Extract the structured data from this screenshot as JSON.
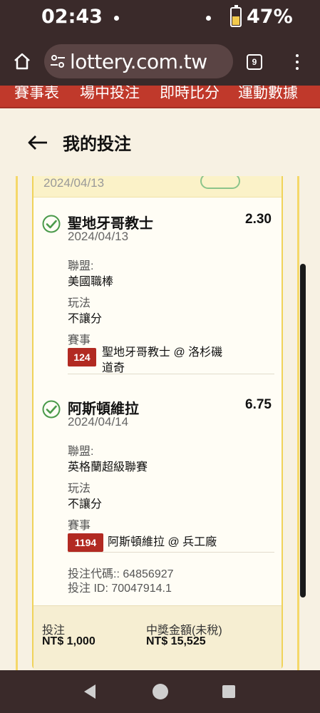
{
  "status_bar": {
    "time": "02:43",
    "battery": "47%"
  },
  "browser": {
    "url": "lottery.com.tw",
    "tab_count": "9"
  },
  "site_nav": {
    "items": [
      "賽事表",
      "場中投注",
      "即時比分",
      "運動數據"
    ]
  },
  "page": {
    "title": "我的投注"
  },
  "bet_card": {
    "header_date": "2024/04/13",
    "selections": [
      {
        "team": "聖地牙哥教士",
        "odds": "2.30",
        "date": "2024/04/13",
        "league_label": "聯盟:",
        "league": "美國職棒",
        "market_label": "玩法",
        "market": "不讓分",
        "event_label": "賽事",
        "event_no": "124",
        "event_line1": "聖地牙哥教士 @ 洛杉磯",
        "event_line2": "道奇"
      },
      {
        "team": "阿斯頓維拉",
        "odds": "6.75",
        "date": "2024/04/14",
        "league_label": "聯盟:",
        "league": "英格蘭超級聯賽",
        "market_label": "玩法",
        "market": "不讓分",
        "event_label": "賽事",
        "event_no": "1194",
        "event_line1": "阿斯頓維拉 @ 兵工廠"
      }
    ],
    "bet_code": "投注代碼:: 64856927",
    "bet_id": "投注 ID: 70047914.1",
    "stake_label": "投注",
    "stake": "NT$ 1,000",
    "payout_label": "中獎金額(未稅)",
    "payout": "NT$ 15,525"
  },
  "colors": {
    "brand_red": "#c0392b",
    "check_green": "#4a9a4a",
    "badge_red": "#b22a22",
    "card_border": "#f0d35a"
  },
  "icons": [
    "home-icon",
    "site-settings-icon",
    "tabs-icon",
    "menu-icon",
    "back-arrow-icon",
    "check-circle-icon"
  ]
}
